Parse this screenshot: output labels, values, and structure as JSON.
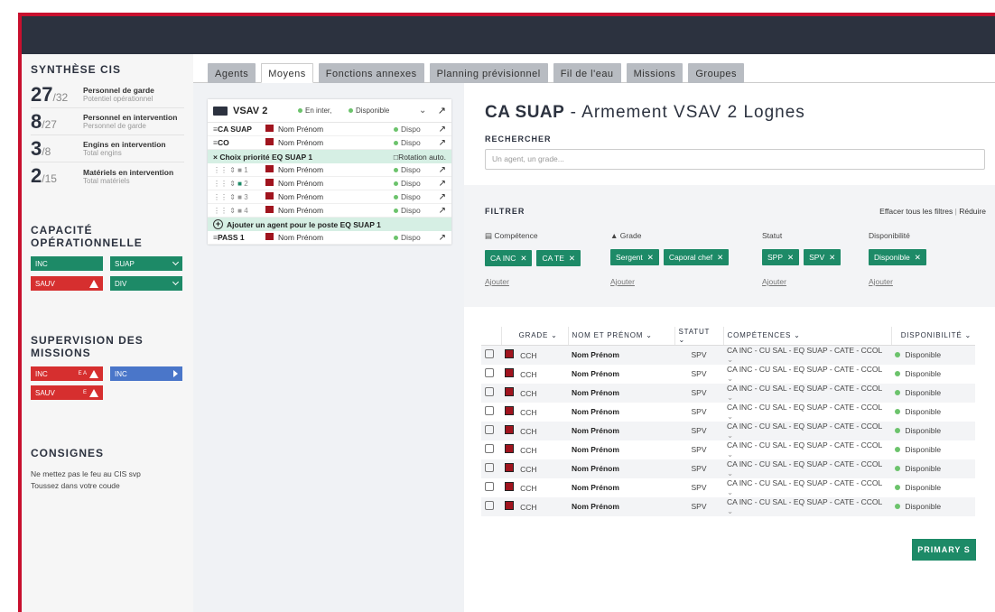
{
  "sidebar": {
    "synth_title": "SYNTHÈSE CIS",
    "stats": [
      {
        "num": "27",
        "den": "/32",
        "label": "Personnel de garde",
        "sub": "Potentiel opérationnel"
      },
      {
        "num": "8",
        "den": "/27",
        "label": "Personnel en intervention",
        "sub": "Personnel de garde"
      },
      {
        "num": "3",
        "den": "/8",
        "label": "Engins en intervention",
        "sub": "Total engins"
      },
      {
        "num": "2",
        "den": "/15",
        "label": "Matériels en intervention",
        "sub": "Total matériels"
      }
    ],
    "capacite_title": "CAPACITÉ OPÉRATIONNELLE",
    "capacite": [
      "INC",
      "SUAP",
      "SAUV",
      "DIV"
    ],
    "supervision_title": "SUPERVISION DES MISSIONS",
    "supervision": [
      {
        "label": "INC",
        "extra": "E A"
      },
      {
        "label": "INC",
        "extra": ""
      },
      {
        "label": "SAUV",
        "extra": "E"
      }
    ],
    "consignes_title": "CONSIGNES",
    "consignes": [
      "Ne mettez pas le feu au CIS svp",
      "Toussez dans votre coude"
    ]
  },
  "tabs": [
    "Agents",
    "Moyens",
    "Fonctions annexes",
    "Planning prévisionnel",
    "Fil de l'eau",
    "Missions",
    "Groupes"
  ],
  "card": {
    "title": "VSAV 2",
    "status1": "En inter,",
    "status2": "Disponible",
    "rows": [
      {
        "role": "CA SUAP",
        "name": "Nom Prénom",
        "status": "Dispo"
      },
      {
        "role": "CO",
        "name": "Nom Prénom",
        "status": "Dispo"
      }
    ],
    "prio_label": "× Choix priorité EQ SUAP 1",
    "rotation": "Rotation auto.",
    "slots": [
      {
        "idx": "1",
        "name": "Nom Prénom",
        "status": "Dispo"
      },
      {
        "idx": "2",
        "name": "Nom Prénom",
        "status": "Dispo"
      },
      {
        "idx": "3",
        "name": "Nom Prénom",
        "status": "Dispo"
      },
      {
        "idx": "4",
        "name": "Nom Prénom",
        "status": "Dispo"
      }
    ],
    "add_label": "Ajouter un agent pour le poste EQ SUAP 1",
    "pass": {
      "role": "PASS 1",
      "name": "Nom Prénom",
      "status": "Dispo"
    }
  },
  "main": {
    "title_bold": "CA SUAP",
    "title_rest": " - Armement VSAV 2 Lognes",
    "search_label": "RECHERCHER",
    "search_placeholder": "Un agent, un grade...",
    "filter_label": "FILTRER",
    "clear_filters": "Effacer tous les filtres",
    "reduce": "Réduire",
    "filters": [
      {
        "title": "Compétence",
        "tags": [
          "CA INC",
          "CA TE"
        ],
        "add": "Ajouter"
      },
      {
        "title": "Grade",
        "tags": [
          "Sergent",
          "Caporal chef"
        ],
        "add": "Ajouter"
      },
      {
        "title": "Statut",
        "tags": [
          "SPP",
          "SPV"
        ],
        "add": "Ajouter"
      },
      {
        "title": "Disponibilité",
        "tags": [
          "Disponible"
        ],
        "add": "Ajouter"
      }
    ],
    "columns": [
      "GRADE",
      "NOM ET PRÉNOM",
      "STATUT",
      "COMPÉTENCES",
      "DISPONIBILITÉ"
    ],
    "rows": [
      {
        "grade": "CCH",
        "name": "Nom Prénom",
        "statut": "SPV",
        "comp": "CA INC - CU SAL - EQ SUAP - CATE - CCOL",
        "dispo": "Disponible"
      },
      {
        "grade": "CCH",
        "name": "Nom Prénom",
        "statut": "SPV",
        "comp": "CA INC - CU SAL - EQ SUAP - CATE - CCOL",
        "dispo": "Disponible"
      },
      {
        "grade": "CCH",
        "name": "Nom Prénom",
        "statut": "SPV",
        "comp": "CA INC - CU SAL - EQ SUAP - CATE - CCOL",
        "dispo": "Disponible"
      },
      {
        "grade": "CCH",
        "name": "Nom Prénom",
        "statut": "SPV",
        "comp": "CA INC - CU SAL - EQ SUAP - CATE - CCOL",
        "dispo": "Disponible"
      },
      {
        "grade": "CCH",
        "name": "Nom Prénom",
        "statut": "SPV",
        "comp": "CA INC - CU SAL - EQ SUAP - CATE - CCOL",
        "dispo": "Disponible"
      },
      {
        "grade": "CCH",
        "name": "Nom Prénom",
        "statut": "SPV",
        "comp": "CA INC - CU SAL - EQ SUAP - CATE - CCOL",
        "dispo": "Disponible"
      },
      {
        "grade": "CCH",
        "name": "Nom Prénom",
        "statut": "SPV",
        "comp": "CA INC - CU SAL - EQ SUAP - CATE - CCOL",
        "dispo": "Disponible"
      },
      {
        "grade": "CCH",
        "name": "Nom Prénom",
        "statut": "SPV",
        "comp": "CA INC - CU SAL - EQ SUAP - CATE - CCOL",
        "dispo": "Disponible"
      },
      {
        "grade": "CCH",
        "name": "Nom Prénom",
        "statut": "SPV",
        "comp": "CA INC - CU SAL - EQ SUAP - CATE - CCOL",
        "dispo": "Disponible"
      }
    ],
    "primary_label": "PRIMARY S"
  },
  "colors": {
    "accent": "#1d8a67",
    "danger": "#d62f2f",
    "info": "#4a76c9",
    "header": "#2c323f",
    "frame": "#c8102e"
  }
}
